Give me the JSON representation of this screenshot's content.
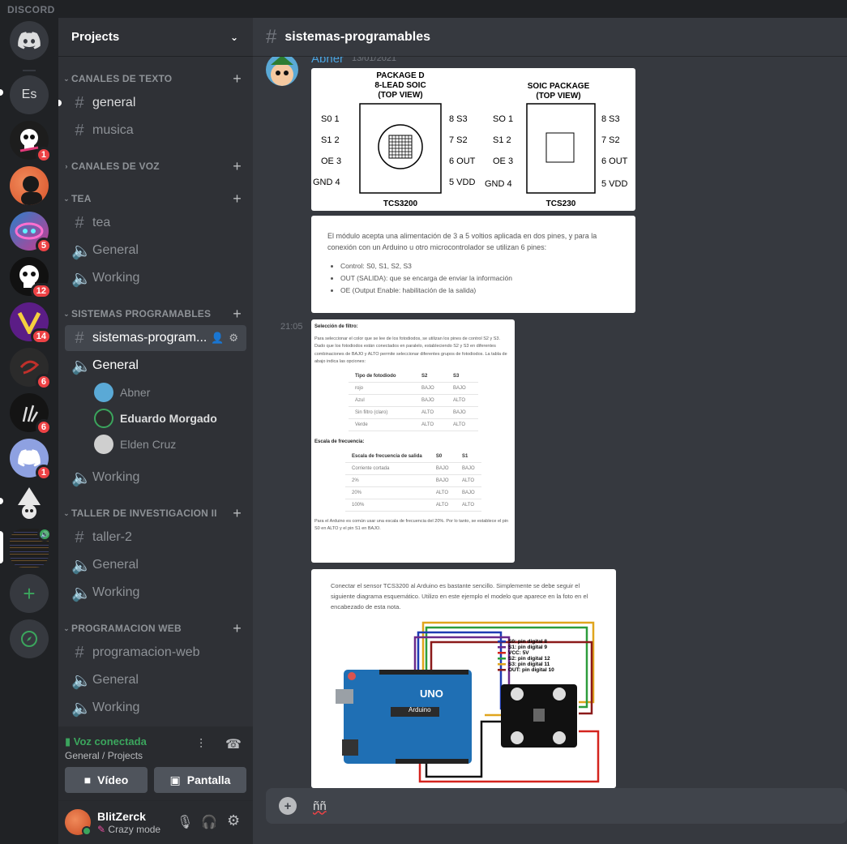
{
  "app": {
    "brand": "DISCORD"
  },
  "guilds": [
    {
      "name": "discord-home-icon",
      "badge": ""
    },
    {
      "name": "server-Es",
      "label": "Es",
      "badge": ""
    },
    {
      "name": "server-skull",
      "badge": "1"
    },
    {
      "name": "server-portrait",
      "badge": ""
    },
    {
      "name": "server-neon",
      "badge": "5"
    },
    {
      "name": "server-ghost",
      "badge": "12"
    },
    {
      "name": "server-v",
      "badge": "14"
    },
    {
      "name": "server-red",
      "badge": "6"
    },
    {
      "name": "server-hand",
      "badge": "6"
    },
    {
      "name": "server-discord-blue",
      "badge": "1"
    },
    {
      "name": "server-wizard",
      "badge": ""
    },
    {
      "name": "server-code",
      "badge": ""
    }
  ],
  "sidebar": {
    "title": "Projects",
    "categories": [
      {
        "label": "CANALES DE TEXTO"
      },
      {
        "label": "CANALES DE VOZ"
      },
      {
        "label": "TEA"
      },
      {
        "label": "SISTEMAS PROGRAMABLES"
      },
      {
        "label": "TALLER DE INVESTIGACION II"
      },
      {
        "label": "PROGRAMACION WEB"
      }
    ],
    "channels": {
      "general": "general",
      "musica": "musica",
      "tea": "tea",
      "tea_general": "General",
      "tea_working": "Working",
      "sistemas": "sistemas-program...",
      "sp_general": "General",
      "sp_working": "Working",
      "taller": "taller-2",
      "taller_general": "General",
      "taller_working": "Working",
      "web": "programacion-web",
      "web_general": "General",
      "web_working": "Working"
    },
    "voice_users": [
      "Abner",
      "Eduardo Morgado",
      "Elden Cruz"
    ],
    "voice": {
      "status": "Voz conectada",
      "location": "General / Projects",
      "video": "Vídeo",
      "screen": "Pantalla"
    },
    "user": {
      "name": "BlitZerck",
      "status": "Crazy mode"
    }
  },
  "main": {
    "channel": "sistemas-programables",
    "author": "Abner",
    "date": "13/01/2021",
    "time2": "21:05",
    "composer_text": "ññ"
  },
  "attachment1": {
    "left_title": [
      "PACKAGE D",
      "8-LEAD SOIC",
      "(TOP VIEW)"
    ],
    "right_title": [
      "SOIC PACKAGE",
      "(TOP VIEW)"
    ],
    "pins_left": [
      "S0 1",
      "S1 2",
      "OE 3",
      "GND 4"
    ],
    "pins_right_a": [
      "8 S3",
      "7 S2",
      "6 OUT",
      "5 VDD"
    ],
    "pins_left_b": [
      "SO 1",
      "S1 2",
      "OE 3",
      "GND 4"
    ],
    "pins_right_b": [
      "8 S3",
      "7 S2",
      "6 OUT",
      "5 VDD"
    ],
    "label_a": "TCS3200",
    "label_b": "TCS230"
  },
  "attachment2": {
    "intro": "El módulo acepta una alimentación de 3 a 5 voltios aplicada en dos pines, y para la conexión con un Arduino u otro microcontrolador se utilizan 6 pines:",
    "bullets": [
      "Control: S0, S1, S2, S3",
      "OUT (SALIDA): que se encarga de enviar la información",
      "OE (Output Enable: habilitación de la salida)"
    ]
  },
  "attachment3": {
    "h1": "Selección de filtro:",
    "p1": "Para seleccionar el color que se lee de los fotodiodos, se utilizan los pines de control S2 y S3. Dado que los fotodiodos están conectados en paralelo, estableciendo S2 y S3 en diferentes combinaciones de BAJO y ALTO permite seleccionar diferentes grupos de fotodiodos. La tabla de abajo indica las opciones:",
    "t1_head": [
      "Tipo de fotodiodo",
      "S2",
      "S3"
    ],
    "t1_rows": [
      [
        "rojo",
        "BAJO",
        "BAJO"
      ],
      [
        "Azul",
        "BAJO",
        "ALTO"
      ],
      [
        "Sin filtro (claro)",
        "ALTO",
        "BAJO"
      ],
      [
        "Verde",
        "ALTO",
        "ALTO"
      ]
    ],
    "h2": "Escala de frecuencia:",
    "t2_head": [
      "Escala de frecuencia de salida",
      "S0",
      "S1"
    ],
    "t2_rows": [
      [
        "Corriente cortada",
        "BAJO",
        "BAJO"
      ],
      [
        "2%",
        "BAJO",
        "ALTO"
      ],
      [
        "20%",
        "ALTO",
        "BAJO"
      ],
      [
        "100%",
        "ALTO",
        "ALTO"
      ]
    ],
    "p2": "Para el Arduino es común usar una escala de frecuencia del 20%. Por lo tanto, se establece el pin S0 en ALTO y el pin S1 en BAJO."
  },
  "attachment4": {
    "text": "Conectar el sensor TCS3200 al Arduino es bastante sencillo. Simplemente se debe seguir el siguiente diagrama esquemático. Utilizo en este ejemplo el modelo que aparece en la foto en el encabezado de esta nota.",
    "legend": [
      "S0: pin digital 8",
      "S1: pin digital 9",
      "VCC: 5V",
      "S2: pin digital 12",
      "S3: pin digital 11",
      "OUT: pin digital 10"
    ],
    "legend_colors": [
      "#1f3bb3",
      "#6b2a8a",
      "#d4241e",
      "#2d9d3c",
      "#e0a51d",
      "#8b1a1a"
    ],
    "board_label": "UNO",
    "board_sub": "Arduino"
  }
}
